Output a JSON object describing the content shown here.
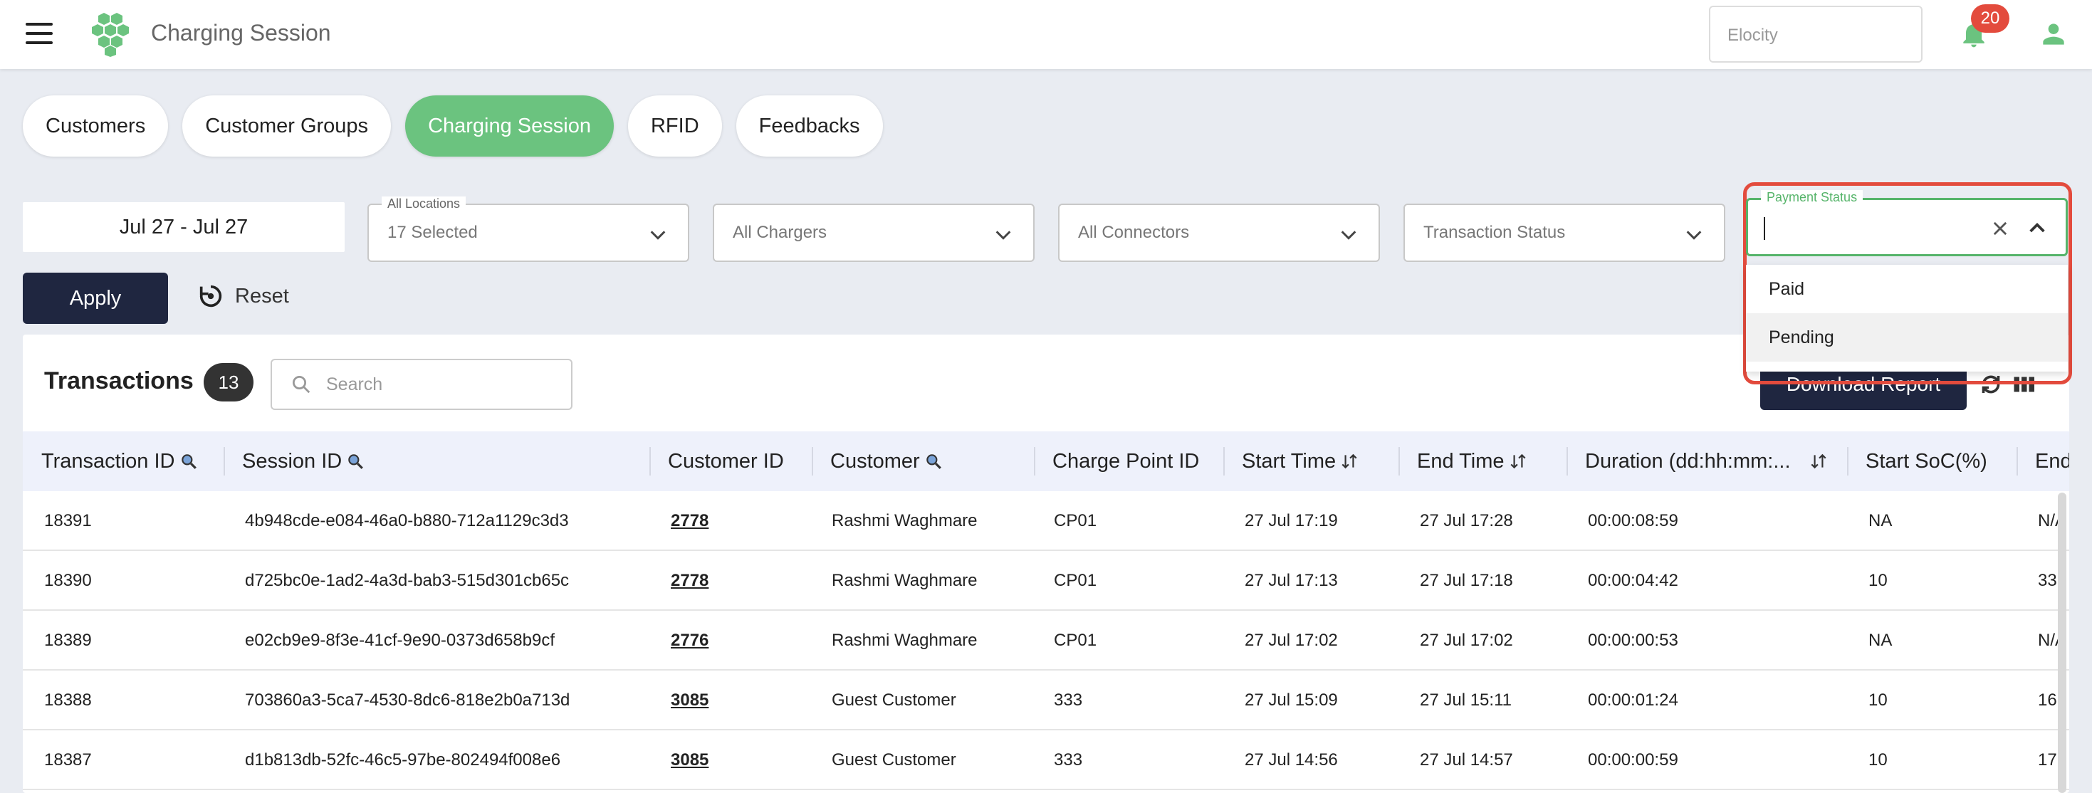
{
  "app": {
    "title": "Charging Session",
    "org_placeholder": "Elocity",
    "notification_count": "20",
    "brand_color": "#6bc37f"
  },
  "tabs": [
    {
      "label": "Customers",
      "active": false
    },
    {
      "label": "Customer Groups",
      "active": false
    },
    {
      "label": "Charging Session",
      "active": true
    },
    {
      "label": "RFID",
      "active": false
    },
    {
      "label": "Feedbacks",
      "active": false
    }
  ],
  "filters": {
    "date_range": "Jul 27 - Jul 27",
    "locations_label": "All Locations",
    "locations_value": "17 Selected",
    "chargers": "All Chargers",
    "connectors": "All Connectors",
    "transaction_status": "Transaction Status",
    "payment_status_label": "Payment Status",
    "payment_status_options": [
      "Paid",
      "Pending"
    ],
    "apply_label": "Apply",
    "reset_label": "Reset"
  },
  "table": {
    "title": "Transactions",
    "count": "13",
    "search_placeholder": "Search",
    "download_label": "Download Report",
    "headers": [
      "Transaction ID",
      "Session ID",
      "Customer ID",
      "Customer",
      "Charge Point ID",
      "Start Time",
      "End Time",
      "Duration (dd:hh:mm:...",
      "Start SoC(%)",
      "End"
    ],
    "rows": [
      [
        "18391",
        "4b948cde-e084-46a0-b880-712a1129c3d3",
        "2778",
        "Rashmi Waghmare",
        "CP01",
        "27 Jul 17:19",
        "27 Jul 17:28",
        "00:00:08:59",
        "NA",
        "N/A"
      ],
      [
        "18390",
        "d725bc0e-1ad2-4a3d-bab3-515d301cb65c",
        "2778",
        "Rashmi Waghmare",
        "CP01",
        "27 Jul 17:13",
        "27 Jul 17:18",
        "00:00:04:42",
        "10",
        "33"
      ],
      [
        "18389",
        "e02cb9e9-8f3e-41cf-9e90-0373d658b9cf",
        "2776",
        "Rashmi Waghmare",
        "CP01",
        "27 Jul 17:02",
        "27 Jul 17:02",
        "00:00:00:53",
        "NA",
        "N/A"
      ],
      [
        "18388",
        "703860a3-5ca7-4530-8dc6-818e2b0a713d",
        "3085",
        "Guest Customer",
        "333",
        "27 Jul 15:09",
        "27 Jul 15:11",
        "00:00:01:24",
        "10",
        "16"
      ],
      [
        "18387",
        "d1b813db-52fc-46c5-97be-802494f008e6",
        "3085",
        "Guest Customer",
        "333",
        "27 Jul 14:56",
        "27 Jul 14:57",
        "00:00:00:59",
        "10",
        "17"
      ]
    ]
  }
}
